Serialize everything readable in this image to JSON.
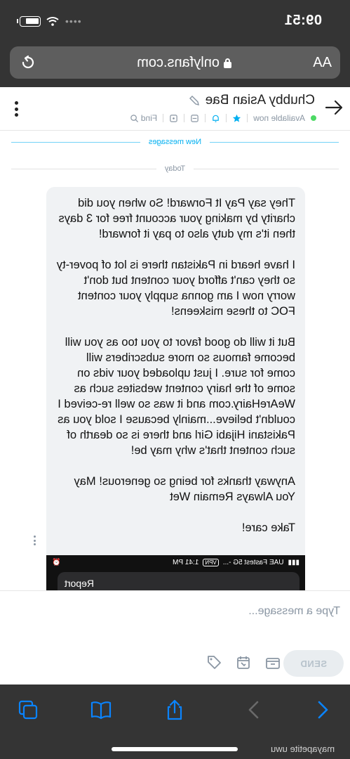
{
  "status_bar": {
    "time": "09:51"
  },
  "browser": {
    "aa_label": "AA",
    "url": "onlyfans.com"
  },
  "chat_header": {
    "name": "Chubby Asian Bae",
    "status": "Available now",
    "find_label": "Find"
  },
  "messages": {
    "new_messages_label": "New messages",
    "date_label": "Today",
    "paragraphs": [
      "They say Pay It Forward! So when you did charity by making your account free for 3 days then it's my duty also to pay it forward!",
      "I have heard in Pakistan there is lot of pover-ty so they can't afford your content but don't worry now I am gonna supply your content FOC to these miskeens!",
      "But it will do good favor to you too as you will become famous so more subscribers will come for sure. I just uploaded your vids on some of the hairy content websites such as WeAreHairy.com and it was so well re-ceived I couldn't believe...mainly because I sold you as Pakistani Hijabi Girl and there is so dearth of such content that's why may be!",
      "Anyway thanks for being so generous! May You Always Remain Wet",
      "Take care!"
    ],
    "embedded_screenshot": {
      "carrier": "UAE Fastest 5G -...",
      "vpn": "VPN",
      "time": "1:41 PM",
      "report_label": "Report"
    }
  },
  "composer": {
    "placeholder": "Type a message...",
    "send_label": "SEND"
  },
  "watermark": "mayapetite uwu",
  "colors": {
    "accent": "#00aff0",
    "online": "#4cd964",
    "chrome_dark": "#343434",
    "toolbar_blue": "#0a84ff"
  }
}
